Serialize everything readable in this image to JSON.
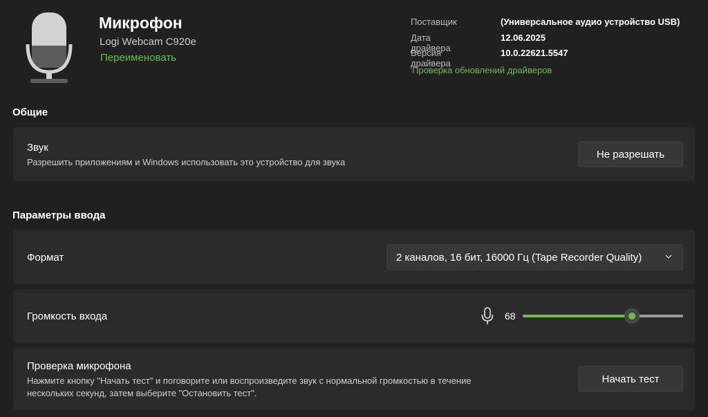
{
  "header": {
    "title": "Микрофон",
    "device_name": "Logi Webcam C920e",
    "rename_link": "Переименовать",
    "mic_icon": "microphone-illustration"
  },
  "driver": {
    "rows": [
      {
        "key": "Поставщик",
        "value": "(Универсальное аудио устройство USB)"
      },
      {
        "key": "Дата драйвера",
        "value": "12.06.2025"
      },
      {
        "key": "Версия драйвера",
        "value": "10.0.22621.5547"
      }
    ],
    "update_link": "Проверка обновлений драйверов"
  },
  "general": {
    "section_title": "Общие",
    "sound": {
      "title": "Звук",
      "subtitle": "Разрешить приложениям и Windows использовать это устройство для звука",
      "button": "Не разрешать"
    }
  },
  "input": {
    "section_title": "Параметры ввода",
    "format": {
      "label": "Формат",
      "value": "2 каналов, 16 бит, 16000 Гц (Tape Recorder Quality)"
    },
    "volume": {
      "label": "Громкость входа",
      "value": "68",
      "level": 0.68,
      "icon": "microphone-icon"
    },
    "test": {
      "title": "Проверка микрофона",
      "subtitle_line1": "Нажмите кнопку \"Начать тест\" и поговорите или воспроизведите звук с нормальной громкостью в течение",
      "subtitle_line2": "нескольких секунд, затем выберите \"Остановить тест\".",
      "button": "Начать тест"
    }
  },
  "colors": {
    "background": "#202020",
    "card": "#2b2b2b",
    "accent": "#6cbf4a",
    "button": "#373737"
  }
}
